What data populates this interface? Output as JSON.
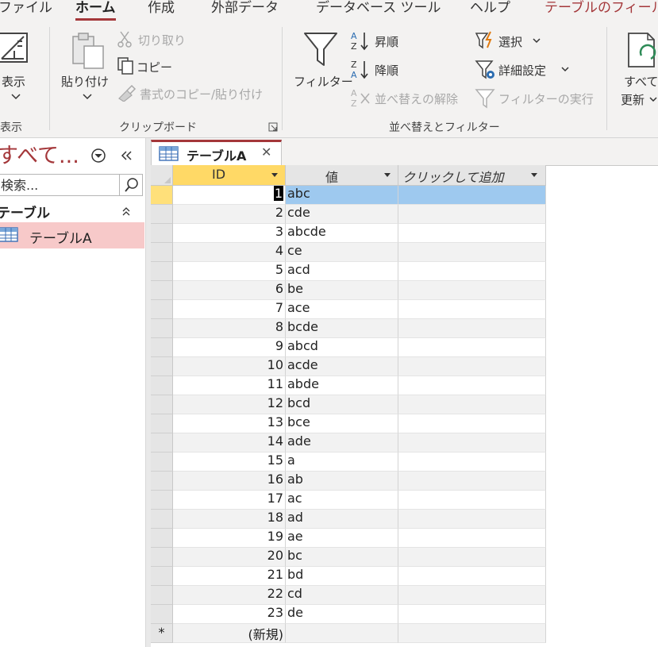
{
  "ribbon_tabs": [
    "ファイル",
    "ホーム",
    "作成",
    "外部データ",
    "データベース ツール",
    "ヘルプ",
    "テーブルのフィールド"
  ],
  "ribbon": {
    "view_group": {
      "button_label": "表示",
      "group_label": "表示"
    },
    "clipboard": {
      "paste_label": "貼り付け",
      "cut_label": "切り取り",
      "copy_label": "コピー",
      "format_painter_label": "書式のコピー/貼り付け",
      "group_label": "クリップボード"
    },
    "sort_filter": {
      "filter_label": "フィルター",
      "ascending_label": "昇順",
      "descending_label": "降順",
      "clear_sort_label": "並べ替えの解除",
      "selection_label": "選択",
      "advanced_label": "詳細設定",
      "toggle_filter_label": "フィルターの実行",
      "group_label": "並べ替えとフィルター"
    },
    "records": {
      "refresh_label_1": "すべて",
      "refresh_label_2": "更新"
    }
  },
  "nav_pane": {
    "title": "すべて...",
    "search_placeholder": "検索...",
    "category": "テーブル",
    "items": [
      {
        "label": "テーブルA"
      }
    ]
  },
  "document": {
    "tab_label": "テーブルA",
    "columns": [
      "ID",
      "値",
      "クリックして追加"
    ],
    "rows": [
      {
        "id": "1",
        "value": "abc"
      },
      {
        "id": "2",
        "value": "cde"
      },
      {
        "id": "3",
        "value": "abcde"
      },
      {
        "id": "4",
        "value": "ce"
      },
      {
        "id": "5",
        "value": "acd"
      },
      {
        "id": "6",
        "value": "be"
      },
      {
        "id": "7",
        "value": "ace"
      },
      {
        "id": "8",
        "value": "bcde"
      },
      {
        "id": "9",
        "value": "abcd"
      },
      {
        "id": "10",
        "value": "acde"
      },
      {
        "id": "11",
        "value": "abde"
      },
      {
        "id": "12",
        "value": "bcd"
      },
      {
        "id": "13",
        "value": "bce"
      },
      {
        "id": "14",
        "value": "ade"
      },
      {
        "id": "15",
        "value": "a"
      },
      {
        "id": "16",
        "value": "ab"
      },
      {
        "id": "17",
        "value": "ac"
      },
      {
        "id": "18",
        "value": "ad"
      },
      {
        "id": "19",
        "value": "ae"
      },
      {
        "id": "20",
        "value": "bc"
      },
      {
        "id": "21",
        "value": "bd"
      },
      {
        "id": "22",
        "value": "cd"
      },
      {
        "id": "23",
        "value": "de"
      }
    ],
    "new_row_label": "(新規)",
    "new_row_marker": "*"
  },
  "colors": {
    "accent": "#a4373a",
    "selection": "#9ec9ef",
    "current_row": "#ffe07a",
    "nav_selected": "#f7c9c9"
  }
}
